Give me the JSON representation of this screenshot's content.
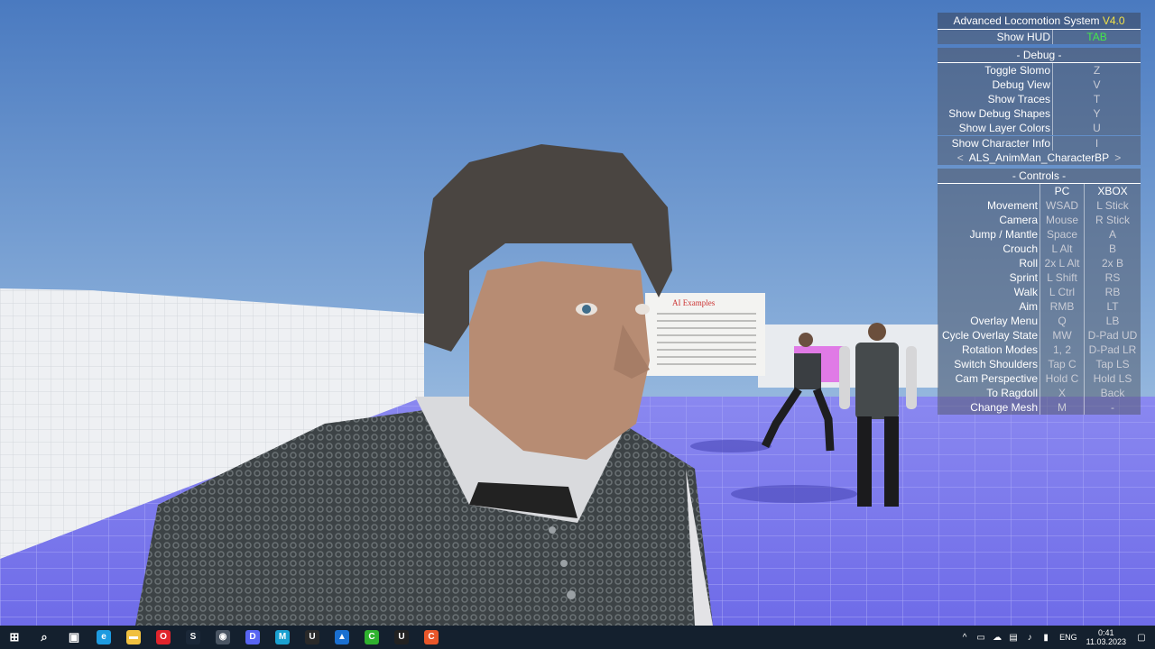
{
  "hud": {
    "title": "Advanced Locomotion System",
    "version": "V4.0",
    "show_hud": {
      "label": "Show HUD",
      "key": "TAB"
    },
    "debug_header": "- Debug -",
    "debug_rows": [
      {
        "label": "Toggle Slomo",
        "key": "Z"
      },
      {
        "label": "Debug View",
        "key": "V"
      },
      {
        "label": "Show Traces",
        "key": "T"
      },
      {
        "label": "Show Debug Shapes",
        "key": "Y"
      },
      {
        "label": "Show Layer Colors",
        "key": "U"
      }
    ],
    "char_info": {
      "label": "Show Character Info",
      "key": "I"
    },
    "character_selector": {
      "prev": "<",
      "value": "ALS_AnimMan_CharacterBP",
      "next": ">"
    },
    "controls_header": "- Controls -",
    "controls_cols": {
      "pc": "PC",
      "xbox": "XBOX"
    },
    "controls": [
      {
        "action": "Movement",
        "pc": "WSAD",
        "xbox": "L Stick"
      },
      {
        "action": "Camera",
        "pc": "Mouse",
        "xbox": "R Stick"
      },
      {
        "action": "Jump / Mantle",
        "pc": "Space",
        "xbox": "A"
      },
      {
        "action": "Crouch",
        "pc": "L Alt",
        "xbox": "B"
      },
      {
        "action": "Roll",
        "pc": "2x L Alt",
        "xbox": "2x B"
      },
      {
        "action": "Sprint",
        "pc": "L Shift",
        "xbox": "RS"
      },
      {
        "action": "Walk",
        "pc": "L Ctrl",
        "xbox": "RB"
      },
      {
        "action": "Aim",
        "pc": "RMB",
        "xbox": "LT"
      },
      {
        "action": "Overlay Menu",
        "pc": "Q",
        "xbox": "LB"
      },
      {
        "action": "Cycle Overlay State",
        "pc": "MW",
        "xbox": "D-Pad UD"
      },
      {
        "action": "Rotation Modes",
        "pc": "1, 2",
        "xbox": "D-Pad LR"
      },
      {
        "action": "Switch Shoulders",
        "pc": "Tap C",
        "xbox": "Tap LS"
      },
      {
        "action": "Cam Perspective",
        "pc": "Hold C",
        "xbox": "Hold LS"
      },
      {
        "action": "To Ragdoll",
        "pc": "X",
        "xbox": "Back"
      },
      {
        "action": "Change Mesh",
        "pc": "M",
        "xbox": "-"
      }
    ]
  },
  "scene": {
    "sign_title": "AI Examples"
  },
  "taskbar": {
    "icons": [
      {
        "name": "windows-start-icon",
        "glyph": "⊞",
        "color": "#ffffff"
      },
      {
        "name": "search-icon",
        "glyph": "⌕",
        "color": "#ffffff"
      },
      {
        "name": "task-view-icon",
        "glyph": "▣",
        "color": "#ffffff"
      },
      {
        "name": "edge-browser-icon",
        "glyph": "e",
        "color": "#1e9be0"
      },
      {
        "name": "file-explorer-icon",
        "glyph": "▬",
        "color": "#f0c040"
      },
      {
        "name": "opera-browser-icon",
        "glyph": "O",
        "color": "#e0242c"
      },
      {
        "name": "steam-icon",
        "glyph": "S",
        "color": "#1b2838"
      },
      {
        "name": "camera-app-icon",
        "glyph": "◉",
        "color": "#4a5563"
      },
      {
        "name": "discord-icon",
        "glyph": "D",
        "color": "#5865f2"
      },
      {
        "name": "m-app-icon",
        "glyph": "M",
        "color": "#1aa0d0"
      },
      {
        "name": "unreal-engine-icon",
        "glyph": "U",
        "color": "#2a2a2a"
      },
      {
        "name": "photos-app-icon",
        "glyph": "▲",
        "color": "#1a6fd0"
      },
      {
        "name": "green-app-icon",
        "glyph": "C",
        "color": "#2fb12f"
      },
      {
        "name": "unreal-engine-active-icon",
        "glyph": "U",
        "color": "#222222"
      },
      {
        "name": "orange-app-icon",
        "glyph": "C",
        "color": "#e8562a"
      }
    ],
    "tray": {
      "language": "ENG",
      "time": "0:41",
      "date": "11.03.2023"
    }
  }
}
